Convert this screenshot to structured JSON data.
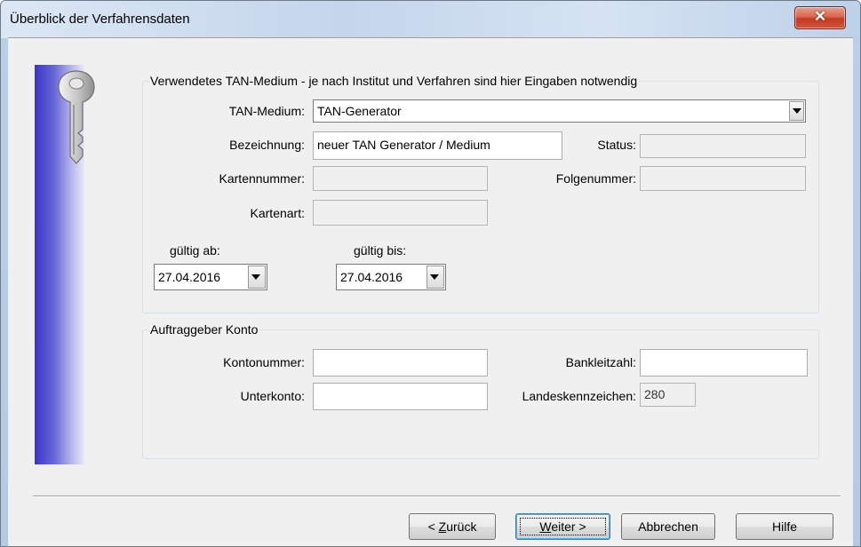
{
  "window": {
    "title": "Überblick der Verfahrensdaten"
  },
  "tan_group": {
    "legend": "Verwendetes TAN-Medium - je nach Institut und Verfahren sind hier Eingaben notwendig",
    "tan_medium_label": "TAN-Medium:",
    "tan_medium_value": "TAN-Generator",
    "bezeichnung_label": "Bezeichnung:",
    "bezeichnung_value": "neuer TAN Generator / Medium",
    "status_label": "Status:",
    "status_value": "",
    "kartennummer_label": "Kartennummer:",
    "kartennummer_value": "",
    "folgenummer_label": "Folgenummer:",
    "folgenummer_value": "",
    "kartenart_label": "Kartenart:",
    "kartenart_value": "",
    "gueltig_ab_label": "gültig ab:",
    "gueltig_ab_value": "27.04.2016",
    "gueltig_bis_label": "gültig bis:",
    "gueltig_bis_value": "27.04.2016"
  },
  "konto_group": {
    "legend": "Auftraggeber Konto",
    "kontonummer_label": "Kontonummer:",
    "kontonummer_value": "",
    "bankleitzahl_label": "Bankleitzahl:",
    "bankleitzahl_value": "",
    "unterkonto_label": "Unterkonto:",
    "unterkonto_value": "",
    "landeskennzeichen_label": "Landeskennzeichen:",
    "landeskennzeichen_value": "280"
  },
  "buttons": {
    "back_prefix": "< ",
    "back_mnemonic": "Z",
    "back_rest": "urück",
    "next_mnemonic": "W",
    "next_rest": "eiter >",
    "cancel": "Abbrechen",
    "help": "Hilfe"
  },
  "icons": {
    "close": "close-icon",
    "key": "key-icon",
    "dropdown": "chevron-down-icon"
  }
}
